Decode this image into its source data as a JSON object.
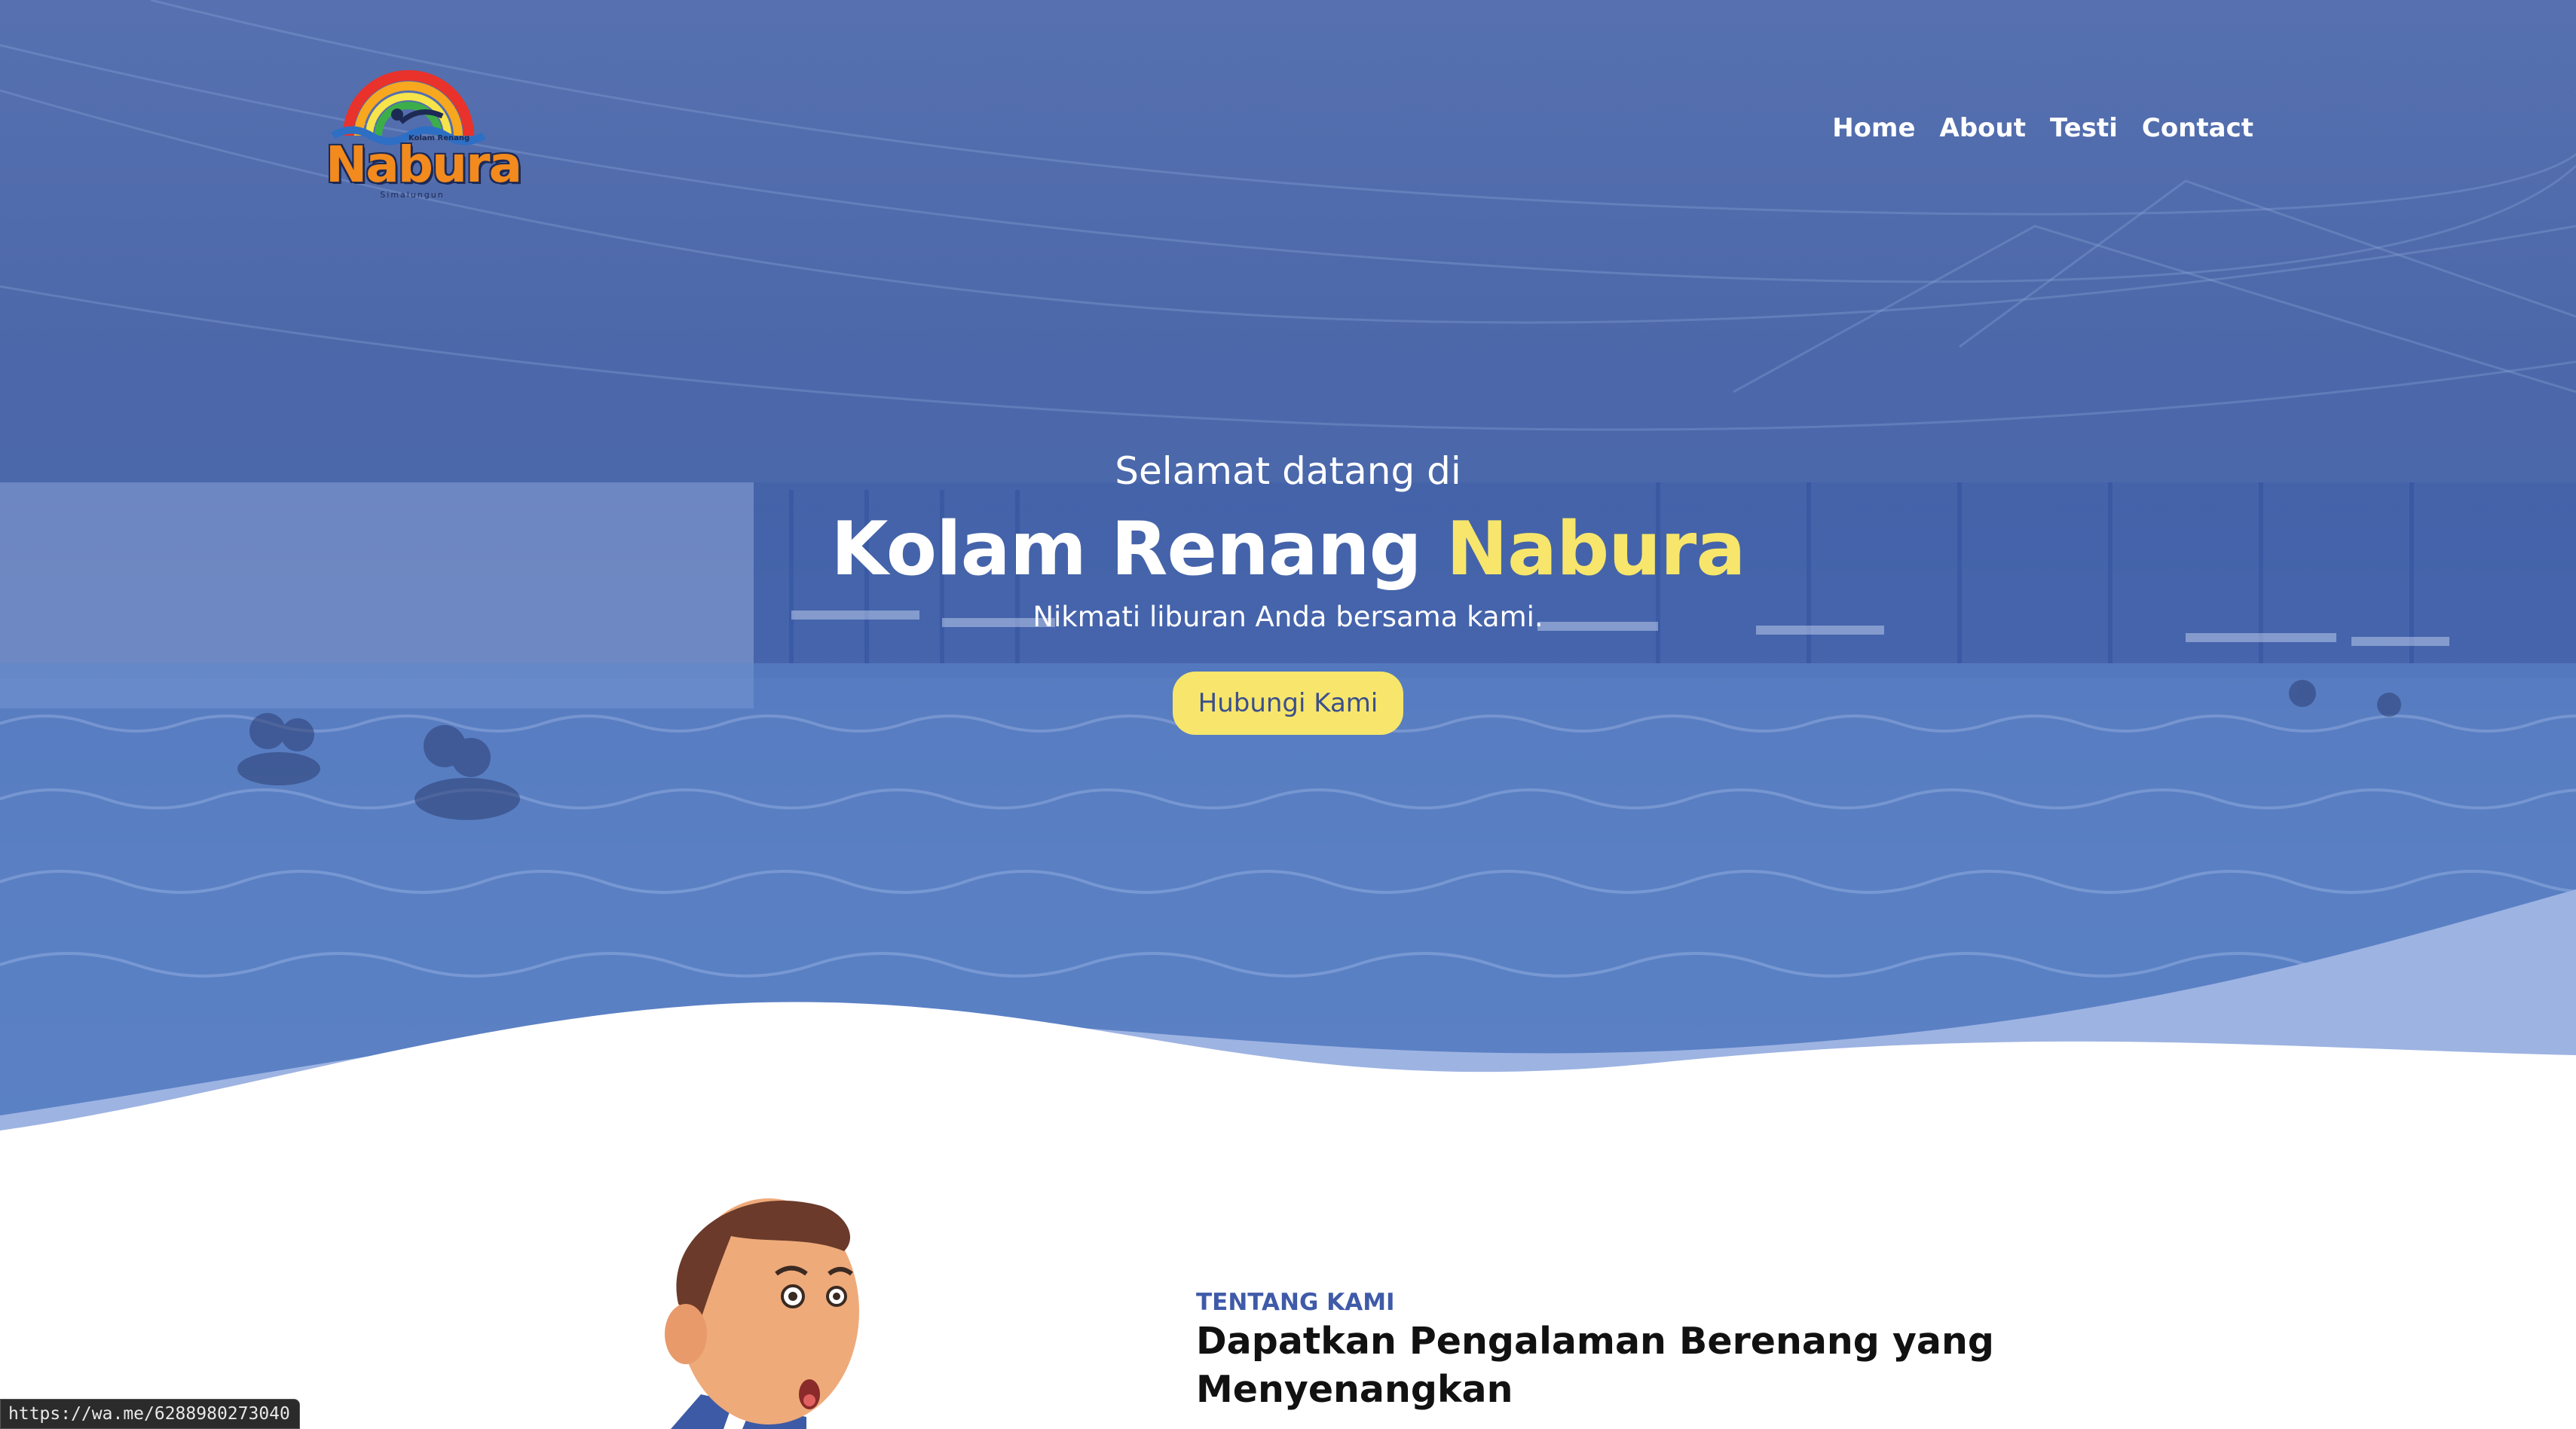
{
  "brand": {
    "logo_text": "Nabura",
    "logo_small": "Kolam Renang",
    "logo_tag": "Simalungun"
  },
  "nav": {
    "items": [
      "Home",
      "About",
      "Testi",
      "Contact"
    ]
  },
  "hero": {
    "subtitle": "Selamat datang di",
    "title_main": "Kolam Renang",
    "title_accent": "Nabura",
    "tagline": "Nikmati liburan Anda bersama kami.",
    "cta_label": "Hubungi Kami"
  },
  "about": {
    "kicker": "TENTANG KAMI",
    "title": "Dapatkan Pengalaman Berenang yang Menyenangkan"
  },
  "status_bar": {
    "url": "https://wa.me/6288980273040"
  },
  "colors": {
    "hero_overlay": "#5a76b9",
    "accent_yellow": "#f7e66b",
    "kicker_blue": "#3f5aa8"
  }
}
